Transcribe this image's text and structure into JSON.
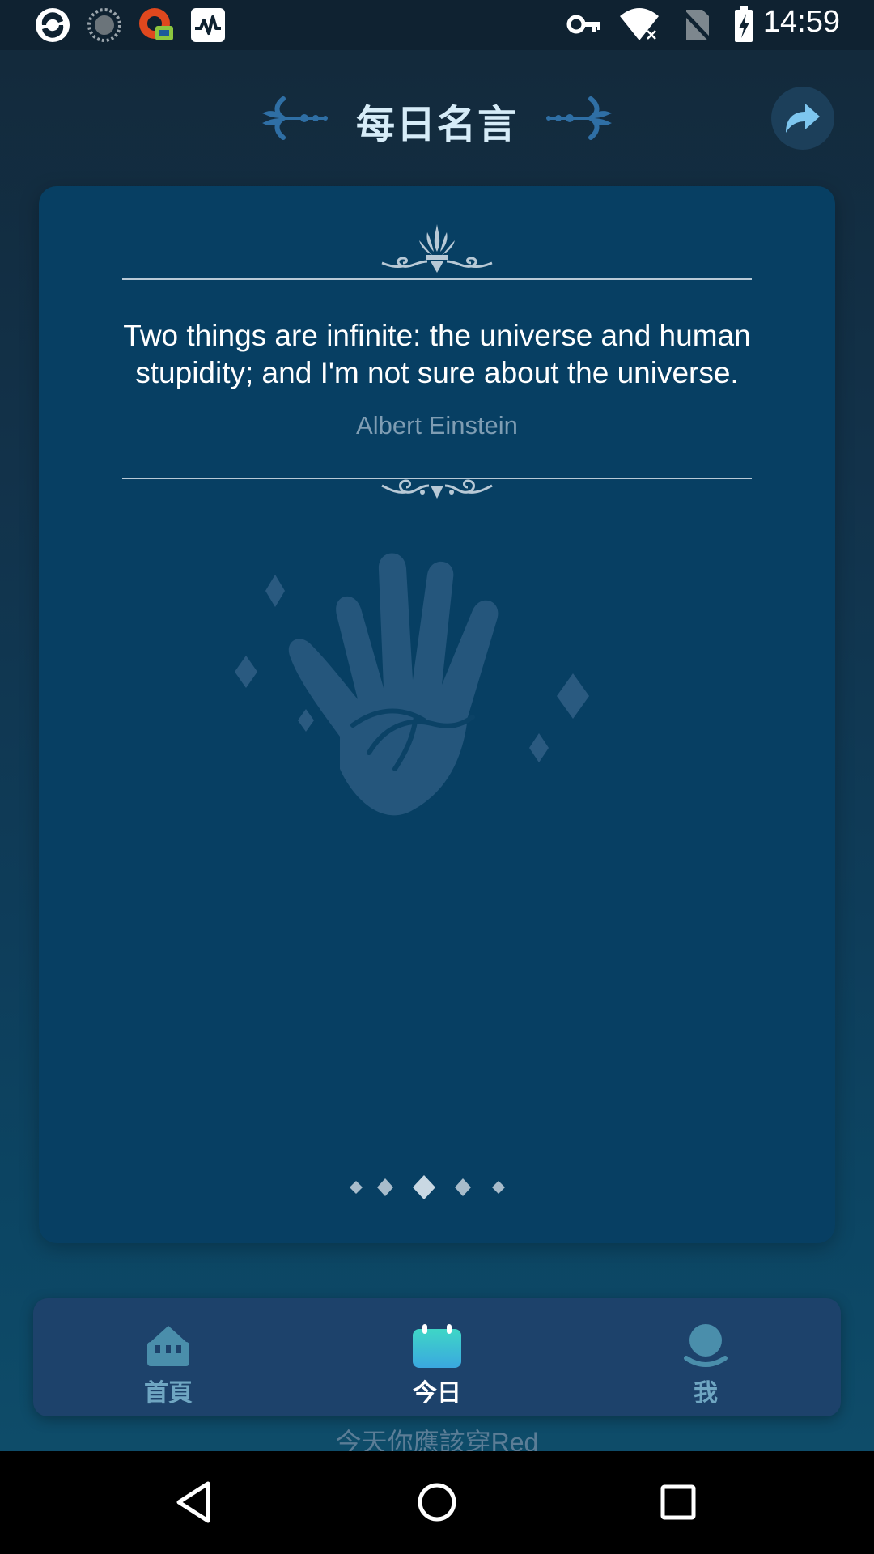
{
  "status_bar": {
    "time": "14:59",
    "left_icons": [
      "app-notification-icon",
      "loading-circle-icon",
      "vpn-app-icon",
      "activity-monitor-icon"
    ],
    "right_icons": [
      "vpn-key-icon",
      "wifi-icon",
      "no-sim-icon",
      "battery-charging-icon"
    ]
  },
  "header": {
    "title": "每日名言",
    "share_icon": "share-arrow-icon"
  },
  "card": {
    "quote": "Two things are infinite: the universe and human stupidity; and I'm not sure about the universe.",
    "author": "Albert Einstein",
    "illustration_icon": "palm-hand-icon",
    "page_indicator_count": 5,
    "page_indicator_active": 3
  },
  "bottom_nav": {
    "items": [
      {
        "label": "首頁",
        "icon": "home-icon",
        "active": false
      },
      {
        "label": "今日",
        "icon": "calendar-icon",
        "active": true
      },
      {
        "label": "我",
        "icon": "profile-icon",
        "active": false
      }
    ]
  },
  "under_text": "今天你應該穿Red",
  "system_nav": {
    "buttons": [
      "back-icon",
      "home-circle-icon",
      "recents-icon"
    ]
  },
  "colors": {
    "card_bg": "#073f63",
    "nav_bg": "#1d426b",
    "accent_teal": "#3fd6c6",
    "title": "#d6ecf8",
    "author": "#7f9db3"
  }
}
